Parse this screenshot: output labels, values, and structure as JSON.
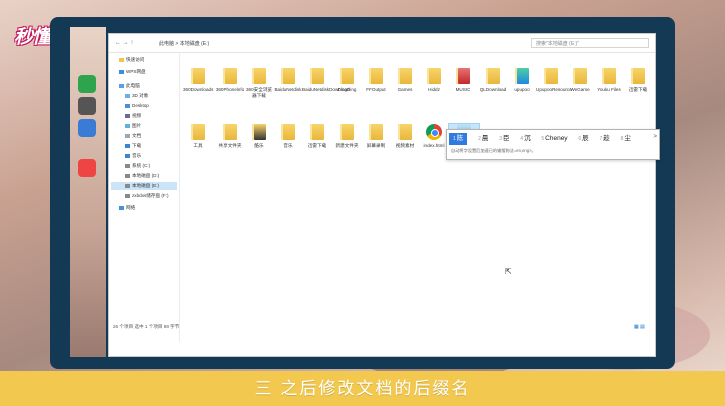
{
  "logo_text": "秒懂视频",
  "caption": "三  之后修改文档的后缀名",
  "address_bar": {
    "nav_arrows": "← → ↑",
    "breadcrumb": "此电脑 > 本地磁盘 (E:)",
    "search_placeholder": "搜索\"本地磁盘 (E:)\""
  },
  "sidebar": {
    "items": [
      {
        "label": "快速访问",
        "icon": "star-icon"
      },
      {
        "label": "WPS网盘",
        "icon": "cloud-icon"
      },
      {
        "label": "此电脑",
        "icon": "computer-icon"
      },
      {
        "label": "3D 对象",
        "icon": "3d-objects-icon"
      },
      {
        "label": "Desktop",
        "icon": "desktop-icon"
      },
      {
        "label": "视频",
        "icon": "video-icon"
      },
      {
        "label": "图片",
        "icon": "picture-icon"
      },
      {
        "label": "文档",
        "icon": "document-icon"
      },
      {
        "label": "下载",
        "icon": "download-icon"
      },
      {
        "label": "音乐",
        "icon": "music-icon"
      },
      {
        "label": "系统 (C:)",
        "icon": "drive-icon"
      },
      {
        "label": "本地磁盘 (D:)",
        "icon": "drive-icon"
      },
      {
        "label": "本地磁盘 (E:)",
        "icon": "drive-icon"
      },
      {
        "label": "zxbdxs储存盘 (F:)",
        "icon": "drive-icon"
      },
      {
        "label": "网络",
        "icon": "network-icon"
      }
    ]
  },
  "files_row1": [
    "360Downloads",
    "360Phonelnfo",
    "360安全浏览器下载",
    "BaiduNetdisk",
    "BaiduNetdiskDownload",
    "DingDing",
    "FFOutput",
    "Games",
    "Hiddz",
    "MUSIC",
    "QLDownload",
    "upupoo",
    "UpupooResource",
    "WeGame",
    "Youku Files",
    "迅雷下载"
  ],
  "files_row2": [
    {
      "name": "工具",
      "type": "folder"
    },
    {
      "name": "共享文件夹",
      "type": "folder"
    },
    {
      "name": "酷乐",
      "type": "folder"
    },
    {
      "name": "音乐",
      "type": "folder"
    },
    {
      "name": "迅雷下载",
      "type": "folder"
    },
    {
      "name": "新建文件夹",
      "type": "folder"
    },
    {
      "name": "屏幕录制",
      "type": "folder"
    },
    {
      "name": "视频素材",
      "type": "folder"
    },
    {
      "name": "index.html",
      "type": "chrome"
    }
  ],
  "rename_item": {
    "value": "新建.che",
    "sub": "n"
  },
  "status_bar": "26 个项目    选中 1 个项目  88 字节",
  "ime": {
    "candidates": [
      {
        "n": "1",
        "text": "陈"
      },
      {
        "n": "2",
        "text": "晨"
      },
      {
        "n": "3",
        "text": "臣"
      },
      {
        "n": "4",
        "text": "沉"
      },
      {
        "n": "5",
        "text": "Cheney"
      },
      {
        "n": "6",
        "text": "辰"
      },
      {
        "n": "7",
        "text": "趁"
      },
      {
        "n": "8",
        "text": "尘"
      }
    ],
    "more": ">",
    "hint": "自动将字设置后加速已的输搜狗法=en,eng>。"
  },
  "colors": {
    "monitor_frame": "#143954",
    "caption_band": "#f2c84f",
    "ime_highlight": "#2f7bde",
    "selection": "#cce4f7"
  }
}
